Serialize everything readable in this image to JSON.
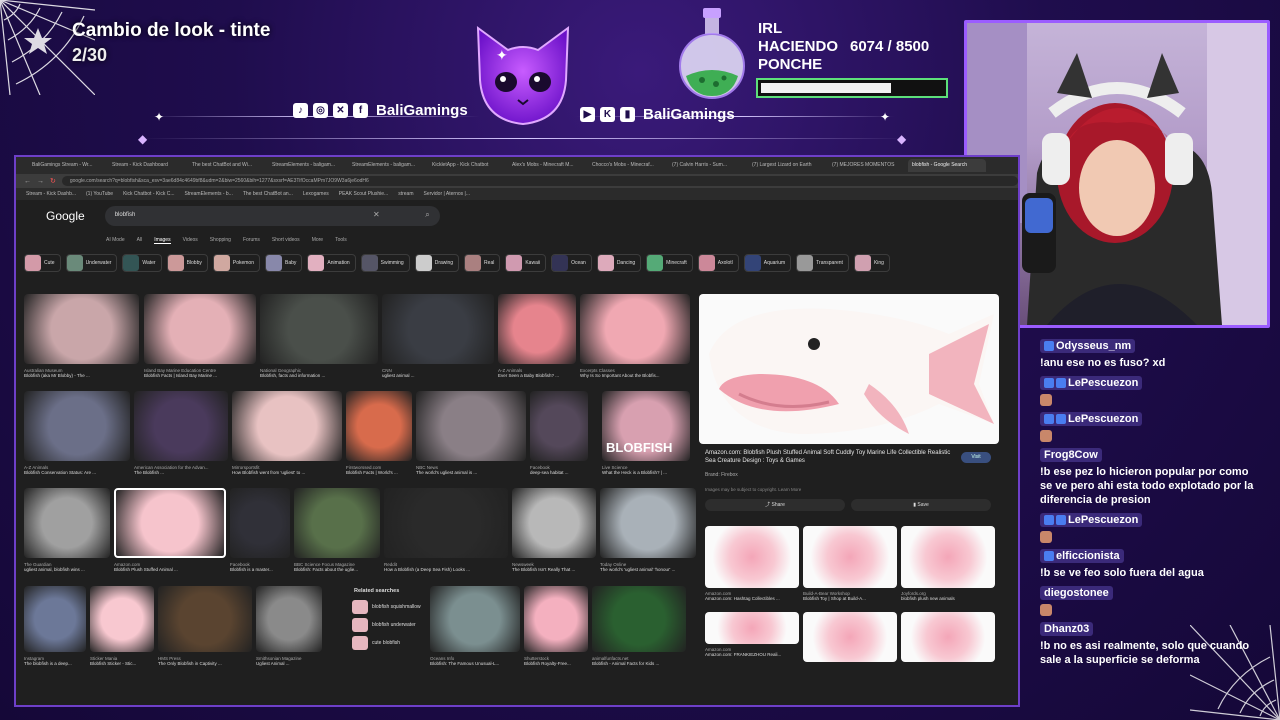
{
  "overlay": {
    "goal_title": "Cambio de look - tinte",
    "goal_count": "2/30",
    "social_left_name": "BaliGamings",
    "social_right_name": "BaliGamings",
    "irl_lines": [
      "IRL",
      "HACIENDO",
      "PONCHE"
    ],
    "progress_text": "6074 / 8500",
    "progress_fraction": 0.715
  },
  "browser": {
    "tabs": [
      "BaliGamings Stream - Wr...",
      "Stream - Kick Dashboard",
      "The best ChatBot and Wi...",
      "StreamElements - baligam...",
      "StreamElements - baligam...",
      "KickletApp - Kick Chatbot",
      "Alex's Mobs - Minecraft M...",
      "Chocco's Mobs - Minecraf...",
      "(7) Calvin Harris - Sum...",
      "(7) Largest Lizard on Earth",
      "(7) MEJORES MOMENTOS",
      "blobfish - Google Search"
    ],
    "url": "google.com/search?q=blobfish&sca_esv=3ae6d84c4649bf8&udm=2&biw=2560&bih=1277&sxsrf=AE3TifOccaMPm7JO9W3a6je6odH6",
    "bookmarks": [
      "Stream - Kick Dashb...",
      "(1) YouTube",
      "Kick Chatbot - Kick C...",
      "StreamElements - b...",
      "The best ChatBot an...",
      "Lexogames",
      "PEAK Scout Plushie...",
      "stream",
      "Servidor | Aternos |..."
    ],
    "google_logo": "Google",
    "search_value": "blobfish",
    "gtabs": [
      "AI Mode",
      "All",
      "Images",
      "Videos",
      "Shopping",
      "Forums",
      "Short videos",
      "More",
      "Tools"
    ],
    "chips": [
      "Cute",
      "Underwater",
      "Water",
      "Blobby",
      "Pokemon",
      "Baby",
      "Animation",
      "Swimming",
      "Drawing",
      "Real",
      "Kawaii",
      "Ocean",
      "Dancing",
      "Minecraft",
      "Axolotl",
      "Aquarium",
      "Transparent",
      "King"
    ],
    "results": [
      {
        "src": "Australian Museum",
        "title": "Blobfish (aka Mr Blobby) - The ..."
      },
      {
        "src": "Island Bay Marine Education Centre",
        "title": "Blobfish Facts | Island Bay Marine ..."
      },
      {
        "src": "National Geographic",
        "title": "Blobfish, facts and information ..."
      },
      {
        "src": "CNN",
        "title": "ugliest animal ..."
      },
      {
        "src": "A-Z Animals",
        "title": "Ever Seen a Baby Blobfish? ..."
      },
      {
        "src": "Excerpts Classes",
        "title": "Why Is So Important About the Blobfis..."
      },
      {
        "src": "A-Z Animals",
        "title": "Blobfish Conservation Status: Are ..."
      },
      {
        "src": "American Association for the Advan...",
        "title": "The Blobfish ..."
      },
      {
        "src": "Mirrorsportsfit",
        "title": "How Blobfish went from 'ugliest' to ..."
      },
      {
        "src": "Firstworssed.com",
        "title": "Blobfish Facts | World's ..."
      },
      {
        "src": "NBC News",
        "title": "The world's ugliest animal is ..."
      },
      {
        "src": "Facebook",
        "title": "deep-sea habitat ..."
      },
      {
        "src": "Live Science",
        "title": "What the Heck is a Blobfish? | ..."
      },
      {
        "src": "The Guardian",
        "title": "ugliest animal, blobfish wins ..."
      },
      {
        "src": "Amazon.com",
        "title": "Blobfish Plush Stuffed Animal ..."
      },
      {
        "src": "Facebook",
        "title": "Blobfish is a master..."
      },
      {
        "src": "BBC Science Focus Magazine",
        "title": "Blobfish: Facts about the uglie..."
      },
      {
        "src": "Reddit",
        "title": "How a Blobfish (a Deep Sea Fish) Looks ..."
      },
      {
        "src": "Newsweek",
        "title": "The Blobfish Isn't Really That ..."
      },
      {
        "src": "Today Online",
        "title": "The world's 'ugliest animal' 'honour' ..."
      },
      {
        "src": "Instagram",
        "title": "The blobfish is a deep..."
      },
      {
        "src": "Sticker Mania",
        "title": "Blobfish Sticker - Stic..."
      },
      {
        "src": "HMS Press",
        "title": "The Only Blobfish in Captivity ..."
      },
      {
        "src": "Smithsonian Magazine",
        "title": "Ugliest Animal ..."
      },
      {
        "src": "Oceans Info",
        "title": "Blobfish: The Famous Unusual-L..."
      },
      {
        "src": "Shutterstock",
        "title": "Blobfish Royalty-Free..."
      },
      {
        "src": "animalfunfacts.net",
        "title": "Blobfish - Animal Facts for Kids ..."
      }
    ],
    "related_title": "Related searches",
    "related": [
      "blobfish squishmallow",
      "blobfish underwater",
      "cute blobfish"
    ],
    "thumb_overlay_text": "BLOBFISH",
    "panel": {
      "title": "Amazon.com: Blobfish Plush Stuffed Animal Soft Cuddly Toy Marine Life Collectible Realistic Sea Creature Design : Toys & Games",
      "brand": "Brand: Firebox",
      "note": "Images may be subject to copyright. Learn More",
      "visit": "Visit",
      "share": "Share",
      "save": "Save",
      "related_items": [
        {
          "src": "Amazon.com",
          "title": "Amazon.com: Hashtag Collectibles ..."
        },
        {
          "src": "Build-A-Bear Workshop",
          "title": "Blobfish Toy | Shop at Build-A..."
        },
        {
          "src": "Joyfords.org",
          "title": "blobfish plush new animals"
        },
        {
          "src": "Amazon.com",
          "title": "Amazon.com: FRANKIEZHOU Reali..."
        }
      ]
    }
  },
  "chat": [
    {
      "user": "Odysseus_nm",
      "text": "!anu ese no es fuso? xd",
      "badges": 1,
      "emote": false
    },
    {
      "user": "LePescuezon",
      "text": "",
      "badges": 2,
      "emote": true
    },
    {
      "user": "LePescuezon",
      "text": "",
      "badges": 2,
      "emote": true
    },
    {
      "user": "Frog8Cow",
      "text": "!b ese pez lo hicieron popular por como se ve pero ahi esta todo explotado por la diferencia de presion",
      "badges": 0,
      "emote": false
    },
    {
      "user": "LePescuezon",
      "text": "",
      "badges": 2,
      "emote": true
    },
    {
      "user": "elficcionista",
      "text": "!b se ve feo solo fuera del agua",
      "badges": 1,
      "emote": false
    },
    {
      "user": "diegostonee",
      "text": "",
      "badges": 0,
      "emote": true
    },
    {
      "user": "Dhanz03",
      "text": "!b no es asi realmente, solo que cuando sale a la superficie se deforma",
      "badges": 0,
      "emote": false
    }
  ]
}
